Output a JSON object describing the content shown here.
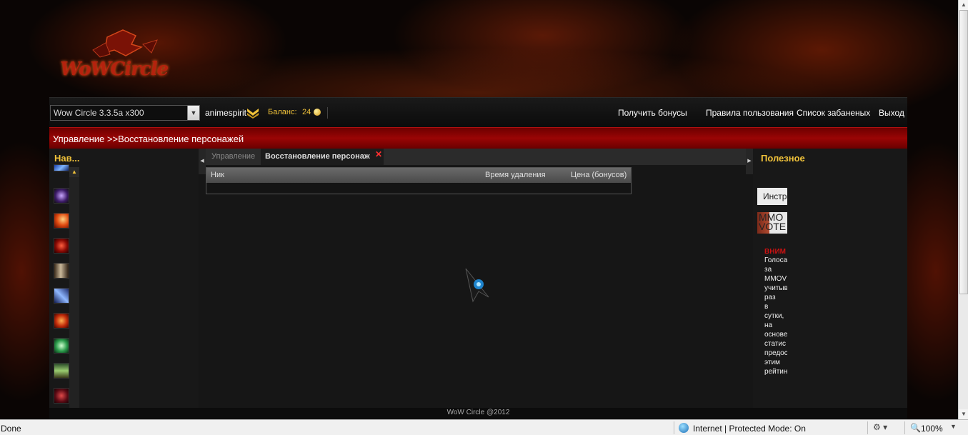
{
  "header": {
    "logo_text": "WoWCircle"
  },
  "topbar": {
    "server_select": "Wow Circle 3.3.5a x300",
    "username": "animespirit",
    "balance_label": "Баланс:",
    "balance_value": "24",
    "nav": [
      "Получить бонусы",
      "Правила пользования",
      "Список забаненых",
      "Выход"
    ]
  },
  "breadcrumb": "Управление >>Восстановление персонажей",
  "left_panel": {
    "title": "Нав...",
    "icons": [
      "spell-icon-blue",
      "spell-icon-purple",
      "spell-icon-fire",
      "spell-icon-red",
      "spell-icon-face",
      "spell-icon-lightning",
      "spell-icon-flame",
      "spell-icon-green-orb",
      "spell-icon-potion",
      "spell-icon-dark-red",
      "spell-icon-green"
    ]
  },
  "tabs": {
    "inactive": "Управление",
    "active": "Восстановление персонаж"
  },
  "table": {
    "columns": [
      "Ник",
      "Время удаления",
      "Цена (бонусов)"
    ]
  },
  "right_panel": {
    "title": "Полезное",
    "instr_tab": "Инстр",
    "vote_line1": "MMO",
    "vote_line2": "VOTE",
    "warn": "ВНИМ",
    "warn_lines": [
      "Голоса",
      "за",
      "MMOV",
      "учитыв",
      "раз",
      "в",
      "сутки,",
      "на",
      "основе",
      "статис",
      "предос",
      "этим",
      "рейтин"
    ]
  },
  "footer": "WoW Circle @2012",
  "statusbar": {
    "left": "Done",
    "zone": "Internet | Protected Mode: On",
    "zoom": "100%"
  },
  "colors": {
    "accent": "#f0c23a",
    "red_bar": "#9a0505",
    "warning": "#cc1111"
  }
}
